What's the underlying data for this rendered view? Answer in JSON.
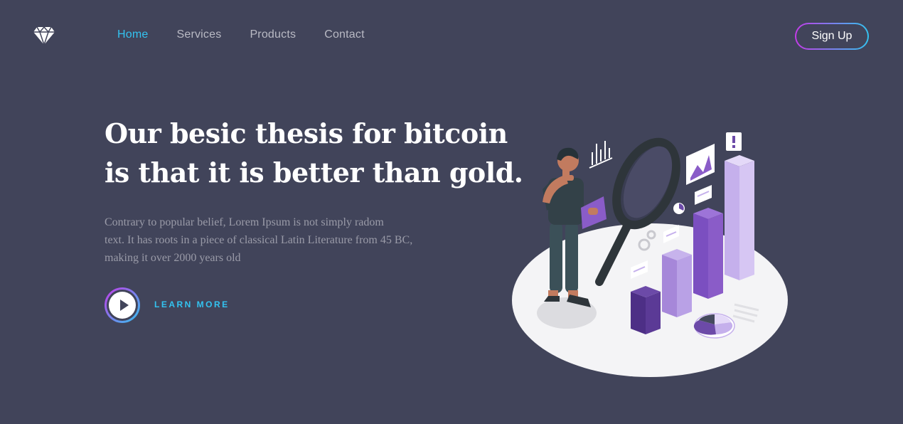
{
  "brand": {
    "logo_icon": "diamond-icon"
  },
  "nav": {
    "items": [
      {
        "label": "Home",
        "active": true
      },
      {
        "label": "Services",
        "active": false
      },
      {
        "label": "Products",
        "active": false
      },
      {
        "label": "Contact",
        "active": false
      }
    ]
  },
  "header": {
    "signup_label": "Sign Up"
  },
  "hero": {
    "headline_line1": "Our besic thesis for bitcoin",
    "headline_line2": "is that it is better than gold.",
    "description_line1": "Contrary to popular belief, Lorem Ipsum is not simply radom",
    "description_line2": "text. It has roots in a piece of classical Latin Literature from 45 BC,",
    "description_line3": "making it over 2000 years old",
    "cta_label": "LEARN MORE",
    "play_icon": "play-icon"
  },
  "illustration": {
    "name": "data-analysis-illustration"
  },
  "colors": {
    "background": "#41445a",
    "accent": "#33c3f0",
    "gradient_start": "#c43be8",
    "gradient_end": "#33c3f0",
    "chart_purple": "#8a5cc8"
  }
}
